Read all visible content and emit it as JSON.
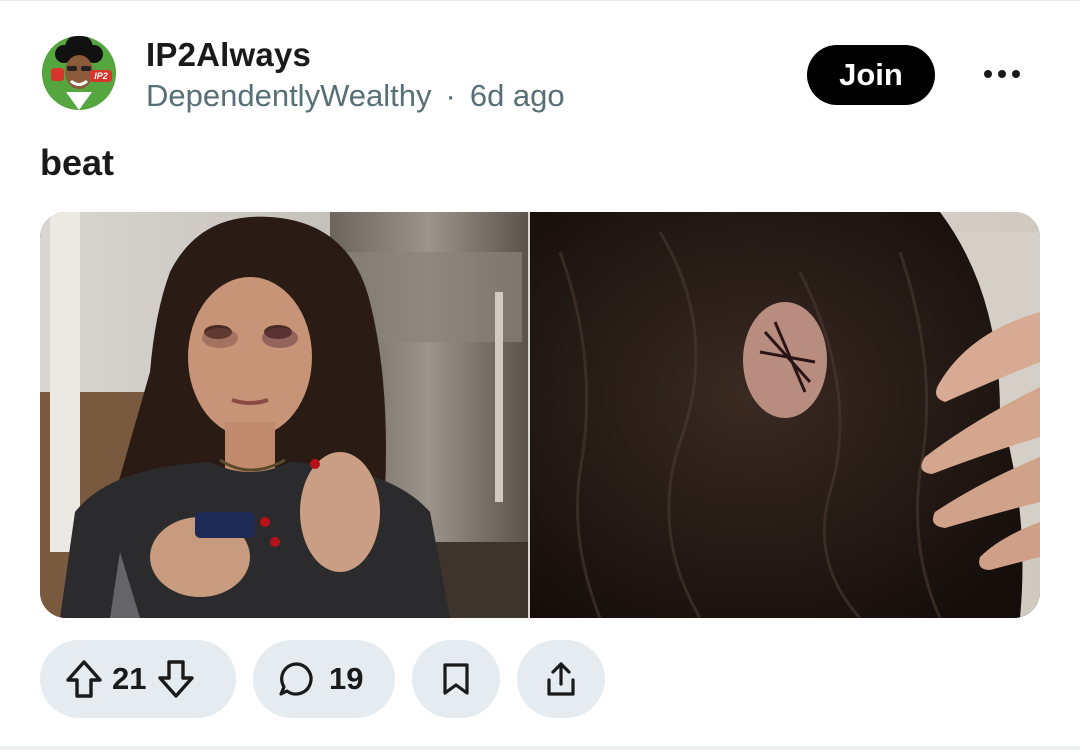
{
  "post": {
    "author": "IP2Always",
    "subreddit": "DependentlyWealthy",
    "separator": "·",
    "time": "6d ago",
    "title": "beat",
    "join_label": "Join",
    "avatar_text": "IP2"
  },
  "actions": {
    "upvotes": "21",
    "comments": "19"
  },
  "icons": {
    "more": "more-horizontal-icon",
    "upvote": "arrow-up-icon",
    "downvote": "arrow-down-icon",
    "comment": "speech-bubble-icon",
    "save": "bookmark-icon",
    "share": "share-icon"
  },
  "colors": {
    "join_bg": "#000000",
    "pill_bg": "#e5ebee",
    "muted_text": "#576f76"
  }
}
